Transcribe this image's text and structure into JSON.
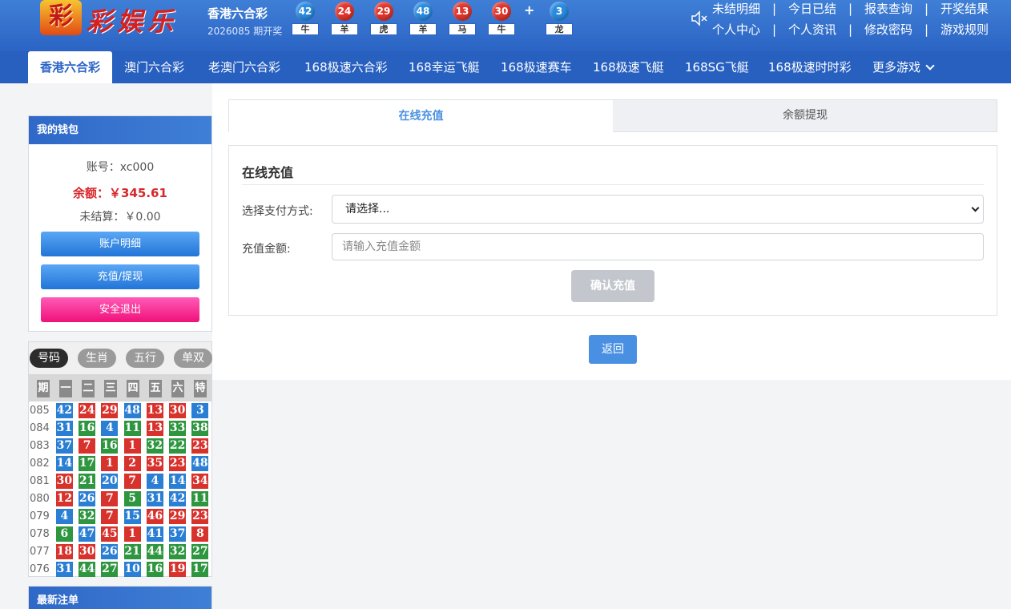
{
  "logo": {
    "text": "彩娱乐",
    "badge": "彩"
  },
  "header": {
    "lottery_name": "香港六合彩",
    "period_text": "2026085 期开奖",
    "draw": [
      {
        "num": "42",
        "zodiac": "牛",
        "color": "blue"
      },
      {
        "num": "24",
        "zodiac": "羊",
        "color": "red"
      },
      {
        "num": "29",
        "zodiac": "虎",
        "color": "red"
      },
      {
        "num": "48",
        "zodiac": "羊",
        "color": "blue"
      },
      {
        "num": "13",
        "zodiac": "马",
        "color": "red"
      },
      {
        "num": "30",
        "zodiac": "牛",
        "color": "red"
      }
    ],
    "plus": "+",
    "special": {
      "num": "3",
      "zodiac": "龙",
      "color": "blue"
    },
    "links_row1": [
      "未结明细",
      "今日已结",
      "报表查询",
      "开奖结果"
    ],
    "links_row2": [
      "个人中心",
      "个人资讯",
      "修改密码",
      "游戏规则"
    ],
    "sep": "|"
  },
  "nav": {
    "tabs": [
      "香港六合彩",
      "澳门六合彩",
      "老澳门六合彩",
      "168极速六合彩",
      "168幸运飞艇",
      "168极速赛车",
      "168极速飞艇",
      "168SG飞艇",
      "168极速时时彩",
      "更多游戏"
    ],
    "active_index": 0
  },
  "wallet": {
    "title": "我的钱包",
    "account": "账号：xc000",
    "balance": "余额：￥345.61",
    "unsettled": "未结算：￥0.00",
    "btn_details": "账户明细",
    "btn_recharge": "充值/提现",
    "btn_logout": "安全退出"
  },
  "history": {
    "tabs": [
      "号码",
      "生肖",
      "五行",
      "单双"
    ],
    "active_tab": 0,
    "headers": [
      "期",
      "一",
      "二",
      "三",
      "四",
      "五",
      "六",
      "特"
    ],
    "rows": [
      {
        "period": "085",
        "nums": [
          "42",
          "24",
          "29",
          "48",
          "13",
          "30",
          "3"
        ],
        "colors": [
          "b",
          "r",
          "r",
          "b",
          "r",
          "r",
          "b"
        ]
      },
      {
        "period": "084",
        "nums": [
          "31",
          "16",
          "4",
          "11",
          "13",
          "33",
          "38"
        ],
        "colors": [
          "b",
          "g",
          "b",
          "g",
          "r",
          "g",
          "g"
        ]
      },
      {
        "period": "083",
        "nums": [
          "37",
          "7",
          "16",
          "1",
          "32",
          "22",
          "23"
        ],
        "colors": [
          "b",
          "r",
          "g",
          "r",
          "g",
          "g",
          "r"
        ]
      },
      {
        "period": "082",
        "nums": [
          "14",
          "17",
          "1",
          "2",
          "35",
          "23",
          "48"
        ],
        "colors": [
          "b",
          "g",
          "r",
          "r",
          "r",
          "r",
          "b"
        ]
      },
      {
        "period": "081",
        "nums": [
          "30",
          "21",
          "20",
          "7",
          "4",
          "14",
          "34"
        ],
        "colors": [
          "r",
          "g",
          "b",
          "r",
          "b",
          "b",
          "r"
        ]
      },
      {
        "period": "080",
        "nums": [
          "12",
          "26",
          "7",
          "5",
          "31",
          "42",
          "11"
        ],
        "colors": [
          "r",
          "b",
          "r",
          "g",
          "b",
          "b",
          "g"
        ]
      },
      {
        "period": "079",
        "nums": [
          "4",
          "32",
          "7",
          "15",
          "46",
          "29",
          "23"
        ],
        "colors": [
          "b",
          "g",
          "r",
          "b",
          "r",
          "r",
          "r"
        ]
      },
      {
        "period": "078",
        "nums": [
          "6",
          "47",
          "45",
          "1",
          "41",
          "37",
          "8"
        ],
        "colors": [
          "g",
          "b",
          "r",
          "r",
          "b",
          "b",
          "r"
        ]
      },
      {
        "period": "077",
        "nums": [
          "18",
          "30",
          "26",
          "21",
          "44",
          "32",
          "27"
        ],
        "colors": [
          "r",
          "r",
          "b",
          "g",
          "g",
          "g",
          "g"
        ]
      },
      {
        "period": "076",
        "nums": [
          "31",
          "44",
          "27",
          "10",
          "16",
          "19",
          "17"
        ],
        "colors": [
          "b",
          "g",
          "g",
          "b",
          "g",
          "r",
          "g"
        ]
      }
    ]
  },
  "latest": {
    "title": "最新注单"
  },
  "main": {
    "tab_recharge": "在线充值",
    "tab_withdraw": "余额提现",
    "form_title": "在线充值",
    "pay_label": "选择支付方式:",
    "pay_value": "请选择...",
    "amount_label": "充值金额:",
    "amount_placeholder": "请输入充值金额",
    "confirm": "确认充值",
    "back": "返回"
  },
  "colors": {
    "red": "#d8322c",
    "blue": "#2a7fd4",
    "green": "#2f9640",
    "accent": "#4a90e2",
    "nav": "#2860c0"
  }
}
